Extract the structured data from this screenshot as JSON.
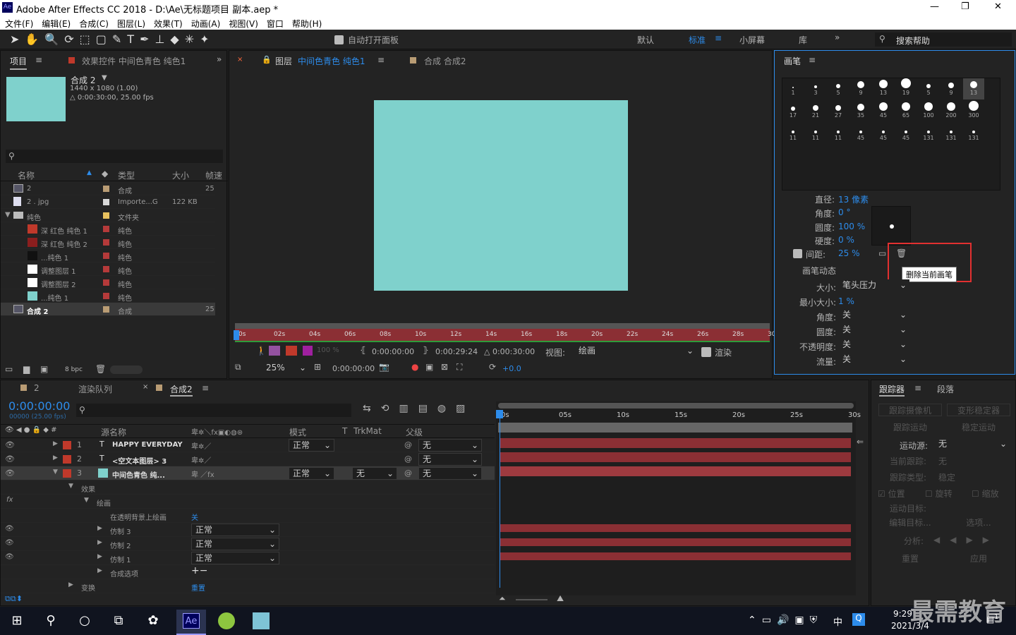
{
  "window": {
    "title": "Adobe After Effects CC 2018 - D:\\Ae\\无标题项目 副本.aep *",
    "app_badge": "Ae",
    "controls": [
      "—",
      "❐",
      "✕"
    ]
  },
  "menu": [
    "文件(F)",
    "编辑(E)",
    "合成(C)",
    "图层(L)",
    "效果(T)",
    "动画(A)",
    "视图(V)",
    "窗口",
    "帮助(H)"
  ],
  "toolbar": {
    "auto_open": "自动打开面板",
    "workspaces": [
      "默认",
      "标准",
      "小屏幕",
      "库"
    ],
    "active_ws": "标准",
    "search": "搜索帮助"
  },
  "project": {
    "tab": "项目",
    "effects_tab": "效果控件 中间色青色 纯色1",
    "comp_name": "合成 2",
    "comp_size": "1440 x 1080 (1.00)",
    "comp_dur": "△ 0:00:30:00, 25.00 fps",
    "cols": [
      "名称",
      "类型",
      "大小",
      "帧速"
    ],
    "rows": [
      {
        "name": "2",
        "type": "合成",
        "size": "",
        "fps": "25",
        "color": "#b99c74",
        "indent": 0,
        "icon": "comp"
      },
      {
        "name": "2 . jpg",
        "type": "Importe...G",
        "size": "122 KB",
        "fps": "",
        "color": "#d8d8d8",
        "indent": 0,
        "icon": "file"
      },
      {
        "name": "纯色",
        "type": "文件夹",
        "size": "",
        "fps": "",
        "color": "#e8c15e",
        "indent": 0,
        "icon": "folder"
      },
      {
        "name": "深 红色 纯色 1",
        "type": "纯色",
        "size": "",
        "fps": "",
        "color": "#b53a3a",
        "indent": 1,
        "icon": "#c0392b"
      },
      {
        "name": "深 红色 纯色 2",
        "type": "纯色",
        "size": "",
        "fps": "",
        "color": "#b53a3a",
        "indent": 1,
        "icon": "#8b1e1e"
      },
      {
        "name": "...纯色 1",
        "type": "纯色",
        "size": "",
        "fps": "",
        "color": "#b53a3a",
        "indent": 1,
        "icon": "#111"
      },
      {
        "name": "调整图层 1",
        "type": "纯色",
        "size": "",
        "fps": "",
        "color": "#b53a3a",
        "indent": 1,
        "icon": "#fff"
      },
      {
        "name": "调整图层 2",
        "type": "纯色",
        "size": "",
        "fps": "",
        "color": "#b53a3a",
        "indent": 1,
        "icon": "#fff"
      },
      {
        "name": "...纯色 1",
        "type": "纯色",
        "size": "",
        "fps": "",
        "color": "#b53a3a",
        "indent": 1,
        "icon": "#7fd1cc"
      },
      {
        "name": "合成 2",
        "type": "合成",
        "size": "",
        "fps": "25",
        "color": "#b99c74",
        "indent": 0,
        "icon": "comp",
        "selected": true
      }
    ],
    "bpc": "8 bpc"
  },
  "viewer": {
    "tab1_prefix": "图层",
    "tab1_name": "中间色青色 纯色1",
    "tab2": "合成 合成2",
    "solid_color": "#7fd1cc",
    "ruler": [
      "0s",
      "02s",
      "04s",
      "06s",
      "08s",
      "10s",
      "12s",
      "14s",
      "16s",
      "18s",
      "20s",
      "22s",
      "24s",
      "26s",
      "28s",
      "30s"
    ],
    "t_in": "0:00:00:00",
    "t_out": "0:00:29:24",
    "t_dur": "△ 0:00:30:00",
    "view_label": "视图:",
    "view_value": "绘画",
    "render": "渲染",
    "zoom": "25%",
    "time": "0:00:00:00",
    "exposure": "+0.0",
    "pct": "100 %"
  },
  "brush": {
    "title": "画笔",
    "sizes": [
      "1",
      "3",
      "5",
      "9",
      "13",
      "19",
      "5",
      "9",
      "13",
      "17",
      "21",
      "27",
      "35",
      "45",
      "65",
      "100",
      "200",
      "300",
      "11",
      "11",
      "11",
      "45",
      "45",
      "45",
      "131",
      "131",
      "131"
    ],
    "diameter_label": "直径:",
    "diameter_value": "13 像素",
    "angle_label": "角度:",
    "angle_value": "0 °",
    "roundness_label": "圆度:",
    "roundness_value": "100 %",
    "hardness_label": "硬度:",
    "hardness_value": "0 %",
    "spacing_label": "间距:",
    "spacing_value": "25 %",
    "dynamics": "画笔动态",
    "tooltip": "删除当前画笔",
    "dyn": [
      {
        "label": "大小:",
        "value": "笔头压力"
      },
      {
        "label": "最小大小:",
        "value": "1 %",
        "plain": true
      },
      {
        "label": "角度:",
        "value": "关"
      },
      {
        "label": "圆度:",
        "value": "关"
      },
      {
        "label": "不透明度:",
        "value": "关"
      },
      {
        "label": "流量:",
        "value": "关"
      }
    ]
  },
  "timeline": {
    "tabs": [
      "2",
      "渲染队列",
      "合成2"
    ],
    "time": "0:00:00:00",
    "frames": "00000 (25.00 fps)",
    "cols": [
      "源名称",
      "模式",
      "T",
      "TrkMat",
      "父级"
    ],
    "ruler": [
      "0s",
      "05s",
      "10s",
      "15s",
      "20s",
      "25s",
      "30s"
    ],
    "layers": [
      {
        "num": "1",
        "type": "T",
        "name": "HAPPY EVERYDAY",
        "mode": "正常",
        "parent": "无"
      },
      {
        "num": "2",
        "type": "T",
        "name": "<空文本图层> 3",
        "mode": "",
        "parent": "无"
      },
      {
        "num": "3",
        "type": "",
        "name": "中间色青色 纯...",
        "mode": "正常",
        "trk": "无",
        "parent": "无"
      }
    ],
    "sub": {
      "effects": "效果",
      "paint": "绘画",
      "paint_on_transparent": "在透明背景上绘画",
      "paint_on_val": "关",
      "clones": [
        {
          "name": "仿制 3",
          "mode": "正常"
        },
        {
          "name": "仿制 2",
          "mode": "正常"
        },
        {
          "name": "仿制 1",
          "mode": "正常"
        }
      ],
      "composite": "合成选项",
      "transform": "变换",
      "reset": "重置"
    }
  },
  "tracker": {
    "tab": "跟踪器",
    "tab2": "段落",
    "btns": [
      [
        "跟踪摄像机",
        "变形稳定器"
      ],
      [
        "跟踪运动",
        "稳定运动"
      ]
    ],
    "source_label": "运动源:",
    "source_value": "无",
    "current_label": "当前跟踪:",
    "current_value": "无",
    "type_label": "跟踪类型:",
    "type_value": "稳定",
    "checks": [
      "位置",
      "旋转",
      "缩放"
    ],
    "target_label": "运动目标:",
    "edit_target": "编辑目标...",
    "options": "选项...",
    "analyze": "分析:",
    "reset": "重置",
    "apply": "应用"
  },
  "taskbar": {
    "time": "9:29",
    "date": "2021/3/4",
    "lang": "中",
    "watermark": "最需教育",
    "notif": "1"
  }
}
